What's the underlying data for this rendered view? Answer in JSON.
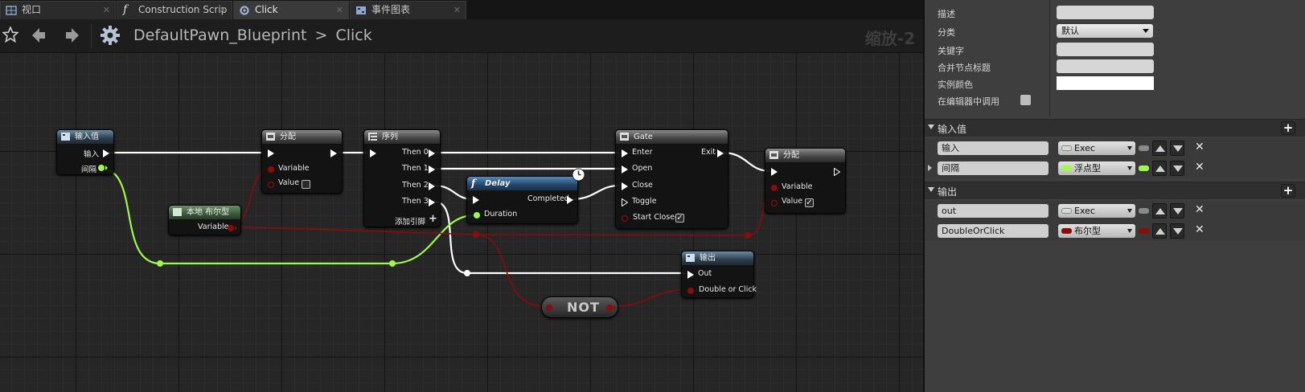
{
  "tabs": [
    {
      "label": "视口",
      "icon": "viewport-grid-icon",
      "active": false
    },
    {
      "label": "Construction Scrip",
      "icon": "function-icon",
      "active": false
    },
    {
      "label": "Click",
      "icon": "macro-icon",
      "active": true
    },
    {
      "label": "事件图表",
      "icon": "event-graph-icon",
      "active": false
    }
  ],
  "header": {
    "breadcrumb_parent": "DefaultPawn_Blueprint",
    "breadcrumb_sep": ">",
    "breadcrumb_current": "Click",
    "zoom": "缩放-2"
  },
  "nodes": {
    "input": {
      "title": "输入值",
      "pins": [
        "输入",
        "间隔"
      ]
    },
    "assign1": {
      "title": "分配",
      "pins": [
        "Variable",
        "Value"
      ]
    },
    "local_bool": {
      "title": "本地 布尔型",
      "pins": [
        "Variable"
      ]
    },
    "sequence": {
      "title": "序列",
      "pins": [
        "Then 0",
        "Then 1",
        "Then 2",
        "Then 3"
      ],
      "add_pin": "添加引脚"
    },
    "delay": {
      "title": "Delay",
      "pins": [
        "Completed",
        "Duration"
      ]
    },
    "gate": {
      "title": "Gate",
      "pins": [
        "Enter",
        "Exit",
        "Open",
        "Close",
        "Toggle",
        "Start Closed"
      ]
    },
    "assign2": {
      "title": "分配",
      "pins": [
        "Variable",
        "Value"
      ]
    },
    "output": {
      "title": "输出",
      "pins": [
        "Out",
        "Double or Click"
      ]
    },
    "not": {
      "title": "NOT"
    }
  },
  "details": {
    "rows": [
      {
        "label": "描述",
        "type": "text"
      },
      {
        "label": "分类",
        "type": "select",
        "value": "默认"
      },
      {
        "label": "关键字",
        "type": "text"
      },
      {
        "label": "合并节点标题",
        "type": "text"
      },
      {
        "label": "实例颜色",
        "type": "color"
      },
      {
        "label": "在编辑器中调用",
        "type": "checkbox"
      }
    ],
    "inputs_title": "输入值",
    "inputs": [
      {
        "name": "输入",
        "type": "Exec",
        "color": "#d8d8d8"
      },
      {
        "name": "间隔",
        "type": "浮点型",
        "color": "#9ef94a"
      }
    ],
    "outputs_title": "输出",
    "outputs": [
      {
        "name": "out",
        "type": "Exec",
        "color": "#d8d8d8"
      },
      {
        "name": "DoubleOrClick",
        "type": "布尔型",
        "color": "#8c0b0b"
      }
    ]
  },
  "colors": {
    "exec": "#ffffff",
    "float": "#9ef94a",
    "bool": "#8c0b0b"
  }
}
